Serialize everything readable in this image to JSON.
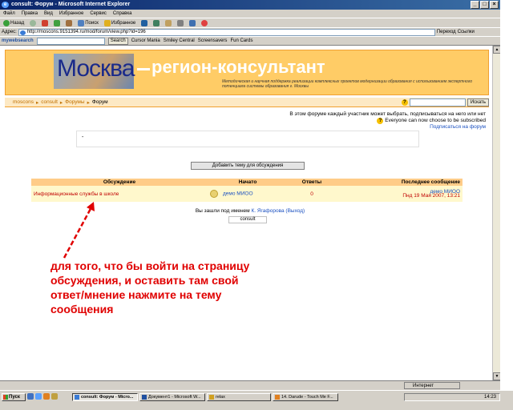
{
  "window": {
    "title": "consult: Форум - Microsoft Internet Explorer"
  },
  "menu": [
    "Файл",
    "Правка",
    "Вид",
    "Избранное",
    "Сервис",
    "Справка"
  ],
  "toolbar": {
    "back": "Назад",
    "search": "Поиск",
    "favorites": "Избранное"
  },
  "address": {
    "label": "Адрес:",
    "url": "http://moscons.9151394.ru/mod/forum/view.php?id=196",
    "go": "Переход",
    "links": "Ссылки"
  },
  "websearch": {
    "brand": "mywebsearch",
    "search_btn": "Search",
    "items": [
      "Cursor Mania",
      "Smiley Central",
      "Screensavers",
      "Fun Cards"
    ]
  },
  "banner": {
    "city": "Москва",
    "dash": "—",
    "region": "регион-консультант",
    "subtitle": "Методическая и научная поддержка реализации комплексных проектов модернизации образования с использованием экспертного потенциала системы образования г. Москвы"
  },
  "nav": {
    "items": [
      "moscons",
      "consult",
      "Форумы",
      "Форум"
    ],
    "search_btn": "Искать",
    "help": "?"
  },
  "info": {
    "line1": "В этом форуме каждый участник может выбрать, подписываться на него или нет",
    "line2": "Everyone can now choose to be subscribed",
    "subscribe": "Подписаться на форум"
  },
  "description": "-",
  "add_topic": "Добавить тему для обсуждения",
  "table": {
    "headers": [
      "Обсуждение",
      "Начато",
      "Ответы",
      "Последнее сообщение"
    ],
    "rows": [
      {
        "topic": "Информационные службы в школе",
        "author": "демо МИОО",
        "replies": "0",
        "last_user": "демо МИОО",
        "last_date": "Пнд 19 Мая 2007, 13:21"
      }
    ]
  },
  "login": {
    "prefix": "Вы зашли под именем",
    "user": "К. Ягафорова",
    "logout": "(Выход)"
  },
  "crumb": "consult",
  "annotation": "для того, что бы войти на страницу обсуждения, и оставить там свой ответ/мнение нажмите на тему сообщения",
  "status": {
    "zone": "Интернет"
  },
  "taskbar": {
    "start": "Пуск",
    "tasks": [
      "consult: Форум - Micro...",
      "Документ1 - Microsoft W...",
      "relax",
      "14. Darude - Touch Me F..."
    ],
    "time": "14:23"
  },
  "colors": {
    "accent": "#ffcc66",
    "link": "#1a50c0",
    "annotation": "#e00000"
  }
}
